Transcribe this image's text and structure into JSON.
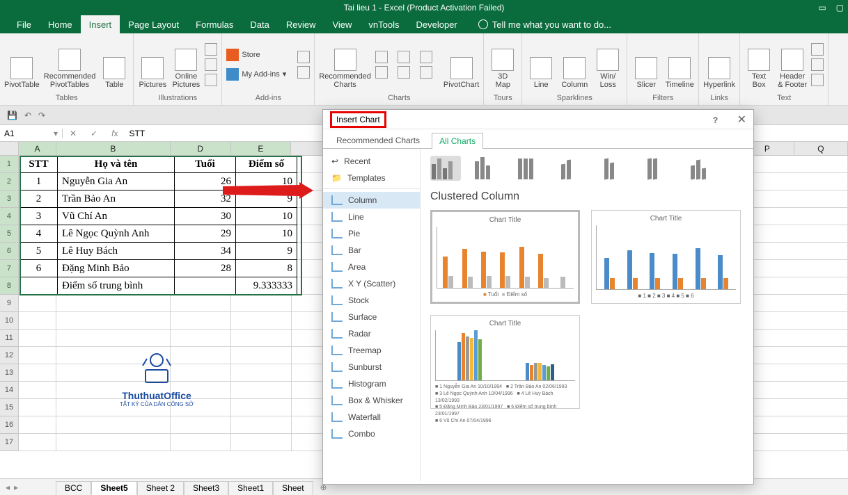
{
  "title": "Tai lieu 1 - Excel (Product Activation Failed)",
  "menu": {
    "file": "File",
    "home": "Home",
    "insert": "Insert",
    "page_layout": "Page Layout",
    "formulas": "Formulas",
    "data": "Data",
    "review": "Review",
    "view": "View",
    "vntools": "vnTools",
    "developer": "Developer",
    "tell": "Tell me what you want to do..."
  },
  "ribbon": {
    "tables": {
      "pivot": "PivotTable",
      "recpivot": "Recommended\nPivotTables",
      "table": "Table",
      "label": "Tables"
    },
    "illus": {
      "pictures": "Pictures",
      "online": "Online\nPictures",
      "label": "Illustrations"
    },
    "addins": {
      "store": "Store",
      "myaddins": "My Add-ins",
      "label": "Add-ins"
    },
    "charts": {
      "rec": "Recommended\nCharts",
      "pivotchart": "PivotChart",
      "label": "Charts"
    },
    "tours": {
      "map": "3D\nMap",
      "label": "Tours"
    },
    "spark": {
      "line": "Line",
      "column": "Column",
      "winloss": "Win/\nLoss",
      "label": "Sparklines"
    },
    "filters": {
      "slicer": "Slicer",
      "timeline": "Timeline",
      "label": "Filters"
    },
    "links": {
      "hyper": "Hyperlink",
      "label": "Links"
    },
    "text": {
      "textbox": "Text\nBox",
      "header": "Header\n& Footer",
      "label": "Text"
    }
  },
  "namebox": "A1",
  "fx_value": "STT",
  "cols": [
    "A",
    "B",
    "D",
    "E",
    "P",
    "Q"
  ],
  "table": {
    "headers": [
      "STT",
      "Họ và tên",
      "Tuổi",
      "Điểm số"
    ],
    "rows": [
      [
        "1",
        "Nguyễn Gia An",
        "26",
        "10"
      ],
      [
        "2",
        "Trần Bảo An",
        "32",
        "9"
      ],
      [
        "3",
        "Vũ Chí An",
        "30",
        "10"
      ],
      [
        "4",
        "Lê Ngọc Quỳnh Anh",
        "29",
        "10"
      ],
      [
        "5",
        "Lê Huy Bách",
        "34",
        "9"
      ],
      [
        "6",
        "Đặng Minh Bảo",
        "28",
        "8"
      ]
    ],
    "footer": [
      "",
      "Điểm số trung bình",
      "",
      "9.333333"
    ]
  },
  "sheets": {
    "items": [
      "BCC",
      "Sheet5",
      "Sheet 2",
      "Sheet3",
      "Sheet1",
      "Sheet"
    ],
    "active": "Sheet5"
  },
  "watermark": {
    "name": "ThuthuatOffice",
    "sub": "TẤT KÝ CỦA DÂN CÔNG SỞ"
  },
  "dialog": {
    "title": "Insert Chart",
    "tabs": {
      "rec": "Recommended Charts",
      "all": "All Charts"
    },
    "cats": [
      "Recent",
      "Templates",
      "Column",
      "Line",
      "Pie",
      "Bar",
      "Area",
      "X Y (Scatter)",
      "Stock",
      "Surface",
      "Radar",
      "Treemap",
      "Sunburst",
      "Histogram",
      "Box & Whisker",
      "Waterfall",
      "Combo"
    ],
    "subtype_name": "Clustered Column",
    "preview_title": "Chart Title",
    "legend1a": "Tuổi",
    "legend1b": "Điểm số"
  },
  "chart_data": {
    "type": "bar",
    "title": "Chart Title",
    "categories": [
      "Nguyễn Gia An",
      "Trần Bảo An",
      "Vũ Chí An",
      "Lê Ngọc Quỳnh Anh",
      "Lê Huy Bách",
      "Đặng Minh Bảo",
      "Điểm số trung bình"
    ],
    "series": [
      {
        "name": "Tuổi",
        "values": [
          26,
          32,
          30,
          29,
          34,
          28,
          null
        ]
      },
      {
        "name": "Điểm số",
        "values": [
          10,
          9,
          10,
          10,
          9,
          8,
          9.33
        ]
      }
    ],
    "ylim": [
      0,
      40
    ]
  }
}
